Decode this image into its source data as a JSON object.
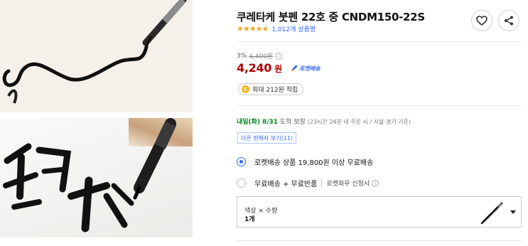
{
  "product": {
    "title": "쿠레타케 붓펜 22호 중 CNDM150-22S",
    "stars": "★★★★★",
    "review_count": "1,012개 상품평"
  },
  "pricing": {
    "discount_rate": "3%",
    "original_price": "4,400원",
    "price": "4,240",
    "currency": "원",
    "rocket_label": "로켓배송",
    "points": "최대 212원 적립",
    "coin_symbol": "C"
  },
  "delivery": {
    "arrival_prefix": "내일(화)",
    "arrival_date": "8/31",
    "arrival_suffix": "도착 보장",
    "condition": "(23시간 24분  내 주문 시 / 서울⋅경기 기준)",
    "other_sellers": "다른 판매자 보기(11)"
  },
  "shipping_options": [
    {
      "label": "로켓배송 상품 19,800원 이상 무료배송",
      "selected": true
    },
    {
      "label": "무료배송 + 무료반품",
      "sub": "로켓와우 신청시",
      "selected": false
    }
  ],
  "option_select": {
    "label": "색상 × 수량",
    "value": "1개"
  },
  "colors": {
    "price_red": "#ae0000",
    "accent_blue": "#346aff",
    "delivery_green": "#00891a",
    "star_orange": "#f5a623"
  },
  "icons": [
    "heart-icon",
    "share-icon",
    "info-icon",
    "rocket-icon",
    "coin-icon",
    "chevron-down-icon"
  ]
}
